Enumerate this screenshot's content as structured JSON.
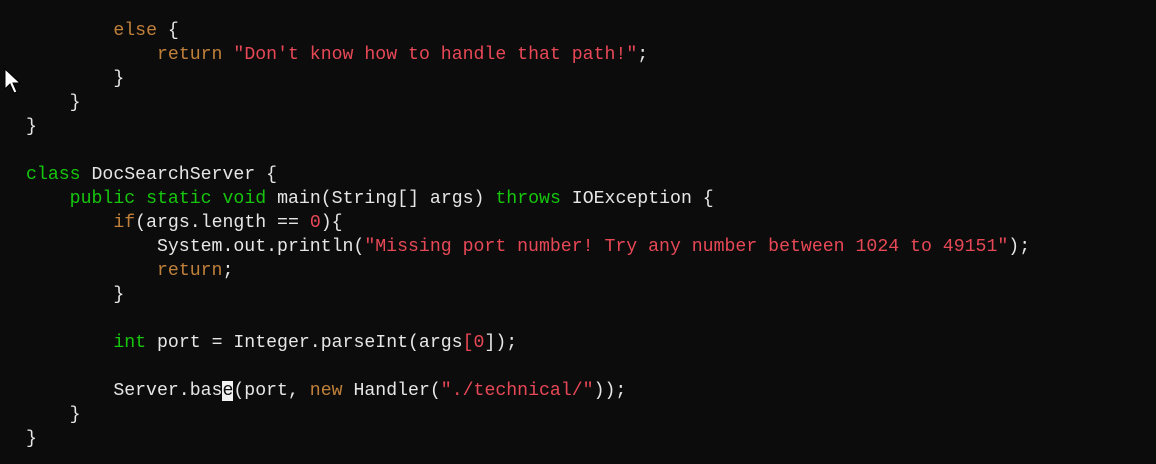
{
  "code_lines": [
    [
      [
        "d",
        "        "
      ],
      [
        "o",
        "else"
      ],
      [
        "d",
        " {"
      ]
    ],
    [
      [
        "d",
        "            "
      ],
      [
        "o",
        "return"
      ],
      [
        "d",
        " "
      ],
      [
        "s",
        "\"Don't know how to handle that path!\""
      ],
      [
        "d",
        ";"
      ]
    ],
    [
      [
        "d",
        "        }"
      ]
    ],
    [
      [
        "d",
        "    }"
      ]
    ],
    [
      [
        "d",
        "}"
      ]
    ],
    [],
    [
      [
        "k",
        "class"
      ],
      [
        "d",
        " DocSearchServer {"
      ]
    ],
    [
      [
        "d",
        "    "
      ],
      [
        "k",
        "public"
      ],
      [
        "d",
        " "
      ],
      [
        "k",
        "static"
      ],
      [
        "d",
        " "
      ],
      [
        "k",
        "void"
      ],
      [
        "d",
        " main(String[] args) "
      ],
      [
        "k",
        "throws"
      ],
      [
        "d",
        " IOException {"
      ]
    ],
    [
      [
        "d",
        "        "
      ],
      [
        "o",
        "if"
      ],
      [
        "d",
        "(args.length == "
      ],
      [
        "s",
        "0"
      ],
      [
        "d",
        "){"
      ]
    ],
    [
      [
        "d",
        "            System.out.println("
      ],
      [
        "s",
        "\"Missing port number! Try any number between 1024 to 49151\""
      ],
      [
        "d",
        ");"
      ]
    ],
    [
      [
        "d",
        "            "
      ],
      [
        "o",
        "return"
      ],
      [
        "d",
        ";"
      ]
    ],
    [
      [
        "d",
        "        }"
      ]
    ],
    [],
    [
      [
        "d",
        "        "
      ],
      [
        "k",
        "int"
      ],
      [
        "d",
        " port = Integer.parseInt(args"
      ],
      [
        "s",
        "[0"
      ],
      [
        "d",
        "]);"
      ]
    ],
    [],
    [
      [
        "d",
        "        Server.bas"
      ],
      [
        "cur",
        "e"
      ],
      [
        "d",
        "(port, "
      ],
      [
        "o",
        "new"
      ],
      [
        "d",
        " Handler("
      ],
      [
        "s",
        "\"./technical/\""
      ],
      [
        "d",
        "));"
      ]
    ],
    [
      [
        "d",
        "    }"
      ]
    ],
    [
      [
        "d",
        "}"
      ]
    ]
  ],
  "colors": {
    "background": "#0c0c0c",
    "default": "#e6e6e6",
    "keyword": "#16c60c",
    "control": "#c0803a",
    "literal": "#e74856"
  }
}
